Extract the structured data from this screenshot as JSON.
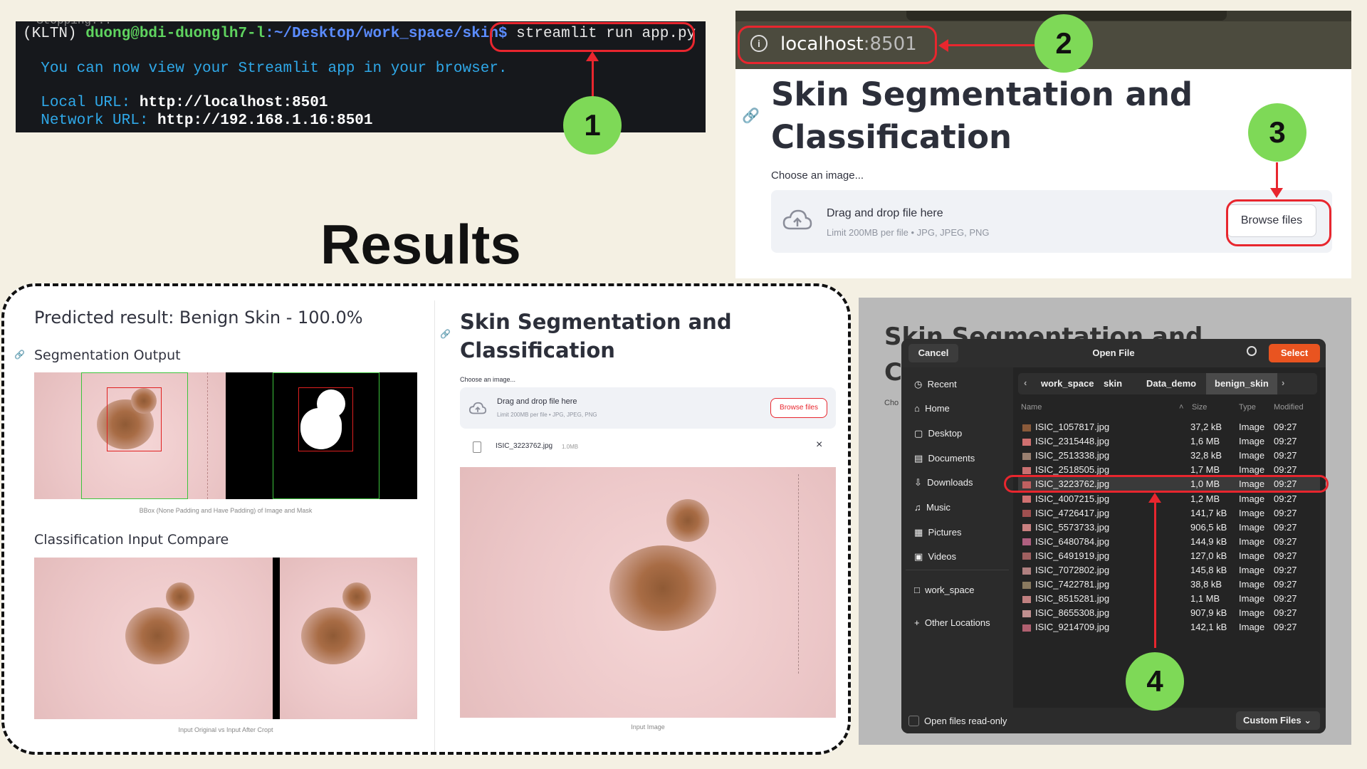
{
  "terminal": {
    "prefix": "(KLTN) ",
    "user": "duong@bdi-duonglh7-l",
    "path": ":~/Desktop/work_space/skin$",
    "command": " streamlit run app.py",
    "msg": "You can now view your Streamlit app in your browser.",
    "local_label": "Local URL: ",
    "local_url": "http://localhost:8501",
    "network_label": "Network URL: ",
    "network_url": "http://192.168.1.16:8501"
  },
  "badges": {
    "b1": "1",
    "b2": "2",
    "b3": "3",
    "b4": "4"
  },
  "browser": {
    "host": "localhost",
    "port": ":8501",
    "title": "Skin Segmentation and Classification",
    "title_l1": "Skin Segmentation and",
    "title_l2": "Classification",
    "choose": "Choose an image...",
    "drag": "Drag and drop file here",
    "limit": "Limit 200MB per file • JPG, JPEG, PNG",
    "browse": "Browse files"
  },
  "results": {
    "heading": "Results",
    "predicted": "Predicted result: Benign Skin - 100.0%",
    "seg": "Segmentation Output",
    "seg_caption": "BBox (None Padding and Have Padding) of Image and Mask",
    "cls": "Classification Input Compare",
    "cls_caption": "Input Original vs Input After Cropt",
    "right_title_l1": "Skin Segmentation and",
    "right_title_l2": "Classification",
    "choose": "Choose an image...",
    "drag": "Drag and drop file here",
    "limit": "Limit 200MB per file • JPG, JPEG, PNG",
    "browse": "Browse files",
    "file": "ISIC_3223762.jpg",
    "size": "1.0MB",
    "close": "×",
    "input_caption": "Input Image"
  },
  "behind": {
    "title_l1": "Skin Segmentation and",
    "title_l2": "C",
    "choo": "Cho"
  },
  "dialog": {
    "cancel": "Cancel",
    "title": "Open File",
    "select": "Select",
    "crumbs": [
      "work_space",
      "skin",
      "Data_demo",
      "benign_skin"
    ],
    "sidebar": [
      "Recent",
      "Home",
      "Desktop",
      "Documents",
      "Downloads",
      "Music",
      "Pictures",
      "Videos",
      "work_space",
      "Other Locations"
    ],
    "cols": {
      "name": "Name",
      "size": "Size",
      "type": "Type",
      "modified": "Modified"
    },
    "files": [
      {
        "name": "ISIC_1057817.jpg",
        "size": "37,2 kB",
        "type": "Image",
        "mod": "09:27"
      },
      {
        "name": "ISIC_2315448.jpg",
        "size": "1,6 MB",
        "type": "Image",
        "mod": "09:27"
      },
      {
        "name": "ISIC_2513338.jpg",
        "size": "32,8 kB",
        "type": "Image",
        "mod": "09:27"
      },
      {
        "name": "ISIC_2518505.jpg",
        "size": "1,7 MB",
        "type": "Image",
        "mod": "09:27"
      },
      {
        "name": "ISIC_3223762.jpg",
        "size": "1,0 MB",
        "type": "Image",
        "mod": "09:27"
      },
      {
        "name": "ISIC_4007215.jpg",
        "size": "1,2 MB",
        "type": "Image",
        "mod": "09:27"
      },
      {
        "name": "ISIC_4726417.jpg",
        "size": "141,7 kB",
        "type": "Image",
        "mod": "09:27"
      },
      {
        "name": "ISIC_5573733.jpg",
        "size": "906,5 kB",
        "type": "Image",
        "mod": "09:27"
      },
      {
        "name": "ISIC_6480784.jpg",
        "size": "144,9 kB",
        "type": "Image",
        "mod": "09:27"
      },
      {
        "name": "ISIC_6491919.jpg",
        "size": "127,0 kB",
        "type": "Image",
        "mod": "09:27"
      },
      {
        "name": "ISIC_7072802.jpg",
        "size": "145,8 kB",
        "type": "Image",
        "mod": "09:27"
      },
      {
        "name": "ISIC_7422781.jpg",
        "size": "38,8 kB",
        "type": "Image",
        "mod": "09:27"
      },
      {
        "name": "ISIC_8515281.jpg",
        "size": "1,1 MB",
        "type": "Image",
        "mod": "09:27"
      },
      {
        "name": "ISIC_8655308.jpg",
        "size": "907,9 kB",
        "type": "Image",
        "mod": "09:27"
      },
      {
        "name": "ISIC_9214709.jpg",
        "size": "142,1 kB",
        "type": "Image",
        "mod": "09:27"
      }
    ],
    "readonly": "Open files read-only",
    "filter": "Custom Files"
  },
  "colors": {
    "accent_red": "#e8262e",
    "badge_green": "#7ed957",
    "select_orange": "#e95420"
  }
}
